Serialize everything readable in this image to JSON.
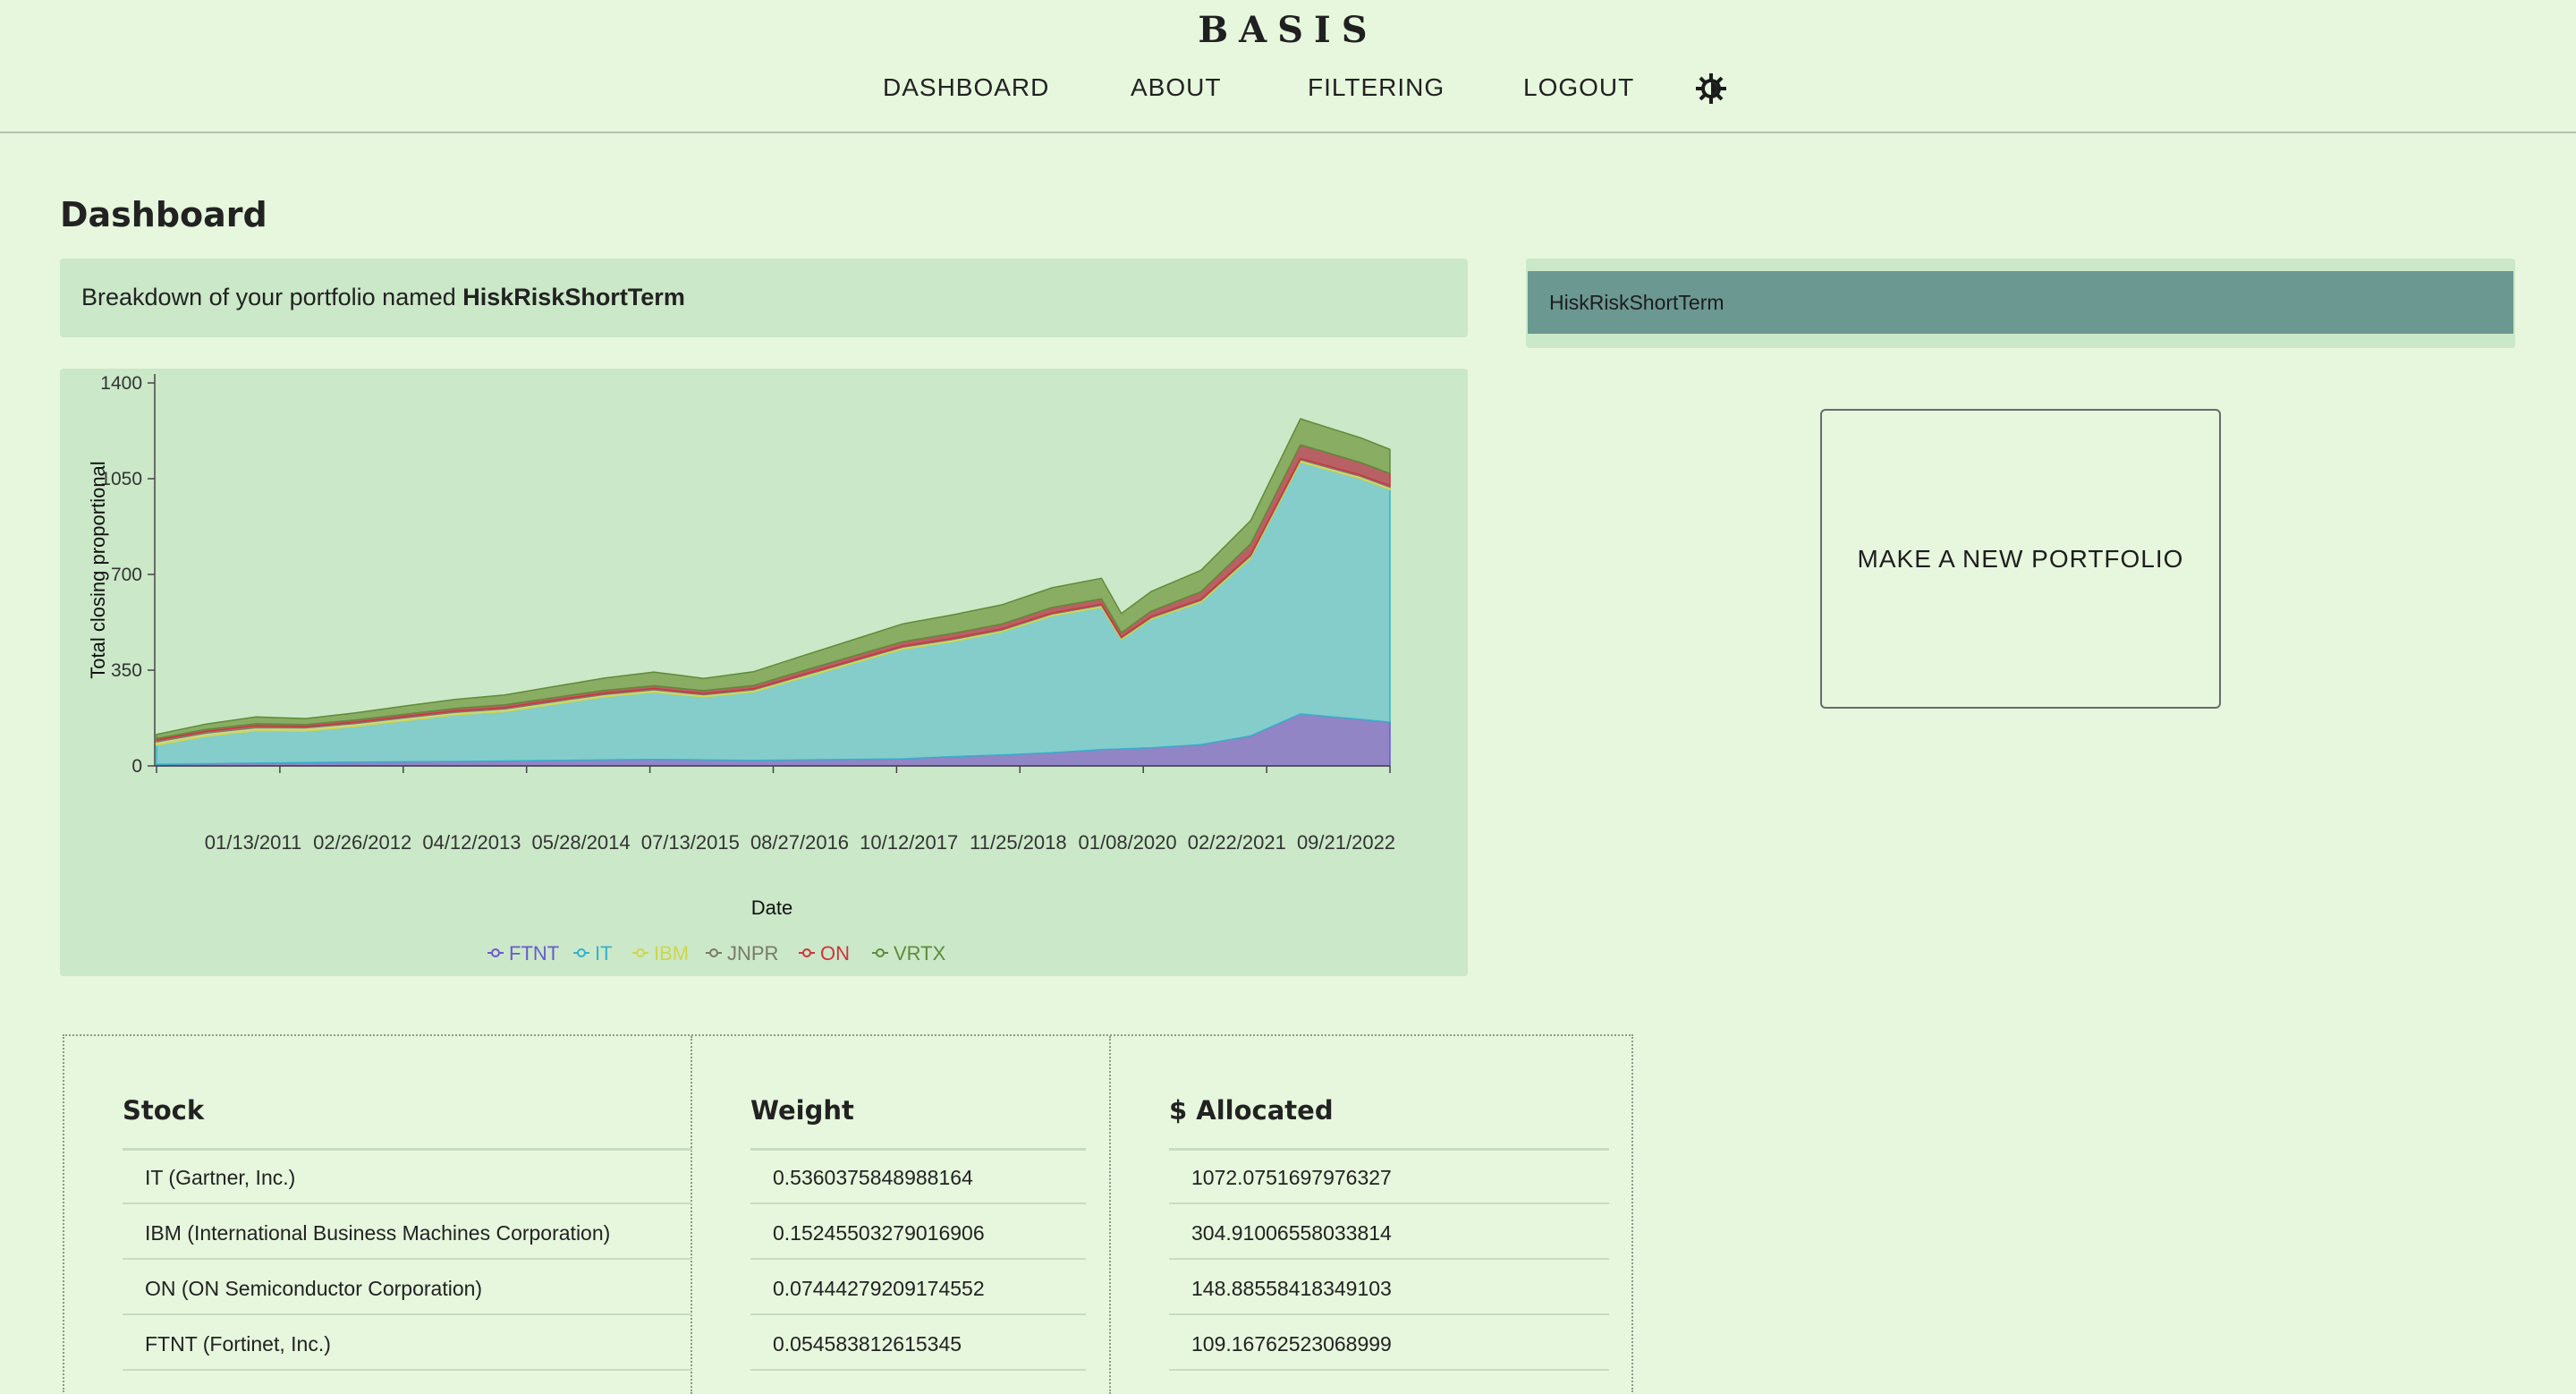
{
  "header": {
    "brand": "BASIS",
    "nav": {
      "dashboard": "DASHBOARD",
      "about": "ABOUT",
      "filtering": "FILTERING",
      "logout": "LOGOUT"
    },
    "theme_toggle_icon": "contrast-icon"
  },
  "page": {
    "title": "Dashboard",
    "breakdown_prefix": "Breakdown of your portfolio named ",
    "portfolio_name": "HiskRiskShortTerm"
  },
  "sidebar": {
    "portfolios": [
      {
        "name": "HiskRiskShortTerm"
      }
    ],
    "new_portfolio_label": "MAKE A NEW PORTFOLIO"
  },
  "chart_data": {
    "type": "area",
    "stacked": true,
    "ylabel": "Total closing proportional",
    "xlabel": "Date",
    "ylim": [
      0,
      1400
    ],
    "yticks": [
      0,
      350,
      700,
      1050,
      1400
    ],
    "xtick_labels": [
      "01/13/2011",
      "02/26/2012",
      "04/12/2013",
      "05/28/2014",
      "07/13/2015",
      "08/27/2016",
      "10/12/2017",
      "11/25/2018",
      "01/08/2020",
      "02/22/2021",
      "09/21/2022"
    ],
    "x": [
      2010.5,
      2011,
      2011.5,
      2012,
      2012.5,
      2013,
      2013.5,
      2014,
      2014.5,
      2015,
      2015.5,
      2016,
      2016.5,
      2017,
      2017.5,
      2018,
      2018.5,
      2019,
      2019.5,
      2020,
      2020.2,
      2020.5,
      2021,
      2021.5,
      2022,
      2022.3,
      2022.6,
      2022.9
    ],
    "legend_position": "bottom",
    "series": [
      {
        "name": "FTNT",
        "color": "#6a5acd",
        "fill": "#8e7fc6",
        "values": [
          6,
          8,
          10,
          12,
          14,
          15,
          16,
          18,
          20,
          22,
          24,
          22,
          20,
          22,
          24,
          26,
          34,
          40,
          48,
          60,
          62,
          66,
          78,
          110,
          190,
          180,
          170,
          160
        ]
      },
      {
        "name": "IT",
        "color": "#39b0cc",
        "fill": "#7fcbcb",
        "values": [
          70,
          100,
          118,
          115,
          130,
          150,
          170,
          180,
          205,
          230,
          245,
          230,
          250,
          300,
          350,
          400,
          420,
          450,
          500,
          520,
          400,
          470,
          520,
          650,
          920,
          900,
          880,
          850
        ]
      },
      {
        "name": "IBM",
        "color": "#cfd64a",
        "fill": "#c9d58a",
        "values": [
          12,
          12,
          12,
          12,
          11,
          11,
          10,
          10,
          10,
          9,
          9,
          8,
          8,
          8,
          8,
          8,
          8,
          7,
          7,
          7,
          6,
          6,
          7,
          8,
          9,
          9,
          9,
          9
        ]
      },
      {
        "name": "JNPR",
        "color": "#7a7a6a",
        "fill": "#a3a37f",
        "values": [
          6,
          6,
          6,
          5,
          5,
          5,
          5,
          5,
          5,
          5,
          5,
          4,
          4,
          4,
          4,
          4,
          4,
          4,
          4,
          4,
          3,
          4,
          4,
          4,
          5,
          5,
          5,
          5
        ]
      },
      {
        "name": "ON",
        "color": "#d0343f",
        "fill": "#b65a5f",
        "values": [
          6,
          7,
          8,
          7,
          8,
          8,
          9,
          10,
          10,
          10,
          10,
          11,
          12,
          14,
          15,
          16,
          18,
          18,
          20,
          20,
          16,
          20,
          28,
          40,
          50,
          48,
          46,
          45
        ]
      },
      {
        "name": "VRTX",
        "color": "#5e8c3a",
        "fill": "#85aa5e",
        "values": [
          15,
          20,
          25,
          22,
          26,
          30,
          33,
          36,
          40,
          45,
          50,
          45,
          50,
          55,
          60,
          65,
          68,
          70,
          72,
          75,
          70,
          72,
          78,
          85,
          95,
          92,
          90,
          88
        ]
      }
    ]
  },
  "allocation_table": {
    "headers": {
      "stock": "Stock",
      "weight": "Weight",
      "allocated": "$ Allocated"
    },
    "rows": [
      {
        "stock": "IT (Gartner, Inc.)",
        "weight": "0.5360375848988164",
        "allocated": "1072.0751697976327"
      },
      {
        "stock": "IBM (International Business Machines Corporation)",
        "weight": "0.15245503279016906",
        "allocated": "304.91006558033814"
      },
      {
        "stock": "ON (ON Semiconductor Corporation)",
        "weight": "0.07444279209174552",
        "allocated": "148.88558418349103"
      },
      {
        "stock": "FTNT (Fortinet, Inc.)",
        "weight": "0.054583812615345",
        "allocated": "109.16762523068999"
      }
    ]
  }
}
